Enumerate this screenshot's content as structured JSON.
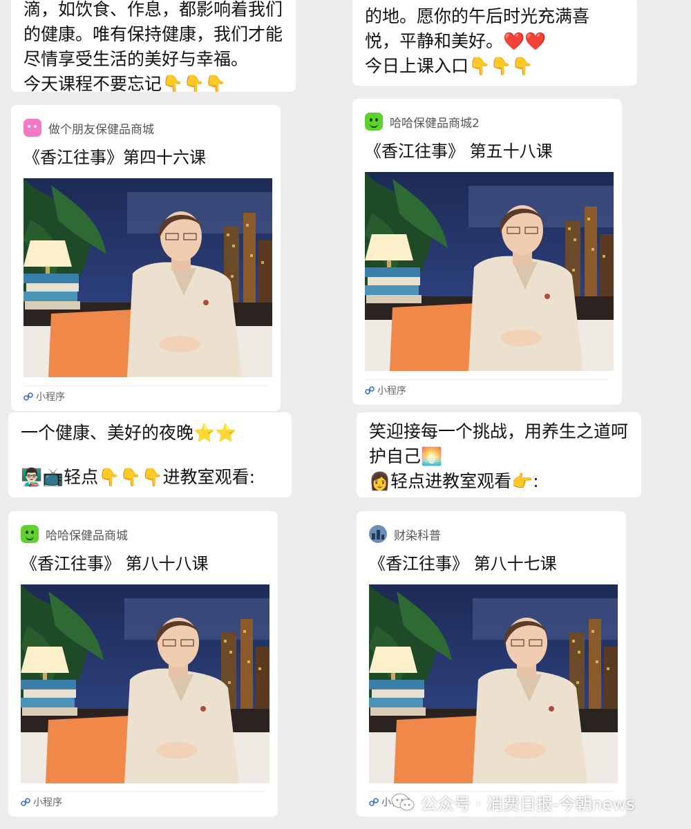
{
  "messages": [
    {
      "lines": [
        "滴，如饮食、作息，都影响着我们",
        "的健康。唯有保持健康，我们才能",
        "尽情享受生活的美好与幸福。",
        " 今天课程不要忘记👇👇👇"
      ]
    },
    {
      "lines": [
        "的地。愿你的午后时光充满喜",
        "悦，平静和美好。❤️❤️",
        " 今日上课入口👇👇👇"
      ]
    },
    {
      "lines": [
        "一个健康、美好的夜晚⭐⭐",
        "",
        "👨🏻‍🏫📺轻点👇👇👇进教室观看:"
      ]
    },
    {
      "lines": [
        "笑迎接每一个挑战，用养生之道呵",
        "护自己🌅",
        " 👩轻点进教室观看👉:"
      ]
    }
  ],
  "cards": [
    {
      "brand_icon": "pink-cat-avatar-icon",
      "brand_color": "#f27ac4",
      "brand_name": "做个朋友保健品商城",
      "title": "《香江往事》第四十六课",
      "footer_label": "小程序"
    },
    {
      "brand_icon": "green-smiley-avatar-icon",
      "brand_color": "#5fd12f",
      "brand_name": "哈哈保健品商城2",
      "title": "《香江往事》 第五十八课",
      "footer_label": "小程序"
    },
    {
      "brand_icon": "green-smiley-avatar-icon",
      "brand_color": "#5fd12f",
      "brand_name": "哈哈保健品商城",
      "title": "《香江往事》 第八十八课",
      "footer_label": "小程序"
    },
    {
      "brand_icon": "city-skyline-avatar-icon",
      "brand_color": "#6d8fb6",
      "brand_name": "财染科普",
      "title": "《香江往事》 第八十七课",
      "footer_label": "小程序"
    }
  ],
  "watermark": {
    "icon": "wechat-official-account-icon",
    "text": "公众号 · 消费日报-今朝news"
  }
}
